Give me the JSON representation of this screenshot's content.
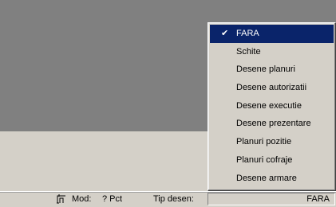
{
  "menu": {
    "items": [
      {
        "label": "FARA",
        "checked": true,
        "highlighted": true
      },
      {
        "label": "Schite"
      },
      {
        "label": "Desene planuri"
      },
      {
        "label": "Desene autorizatii"
      },
      {
        "label": "Desene executie"
      },
      {
        "label": "Desene prezentare"
      },
      {
        "label": "Planuri pozitie"
      },
      {
        "label": "Planuri cofraje"
      },
      {
        "label": "Desene armare"
      }
    ],
    "check_glyph": "✔"
  },
  "statusbar": {
    "mod_icon": "frame-corner-icon",
    "mod_label": "Mod:",
    "mod_value": "? Pct",
    "tip_label": "Tip desen:",
    "tip_value": "FARA"
  },
  "colors": {
    "canvas": "#808080",
    "face": "#d4d0c8",
    "highlight": "#0a246a"
  }
}
